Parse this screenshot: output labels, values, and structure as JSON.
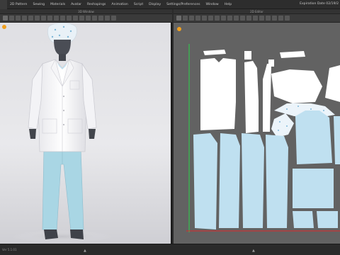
{
  "menubar": {
    "items": [
      "2D Pattern",
      "Sewing",
      "Materials",
      "Avatar",
      "Reshapings",
      "Animation",
      "Script",
      "Display",
      "Settings/Preferences",
      "Window",
      "Help"
    ],
    "expiration": "Expiration Date 02/19/2"
  },
  "panels": {
    "window_3d_title": "3D Window",
    "window_2d_title": "2D Editor"
  },
  "statusbar": {
    "version": "Ver 5.1.01"
  },
  "colors": {
    "background_3d": "#e3e3e6",
    "background_2d": "#626262",
    "pattern_white": "#ffffff",
    "pattern_blue": "#bfe0f0",
    "axis_green": "#2bd44a",
    "axis_red": "#e0282a"
  },
  "scene_3d": {
    "avatar": "mannequin",
    "garments": [
      "cap",
      "lab-coat",
      "scrub-trousers"
    ]
  }
}
